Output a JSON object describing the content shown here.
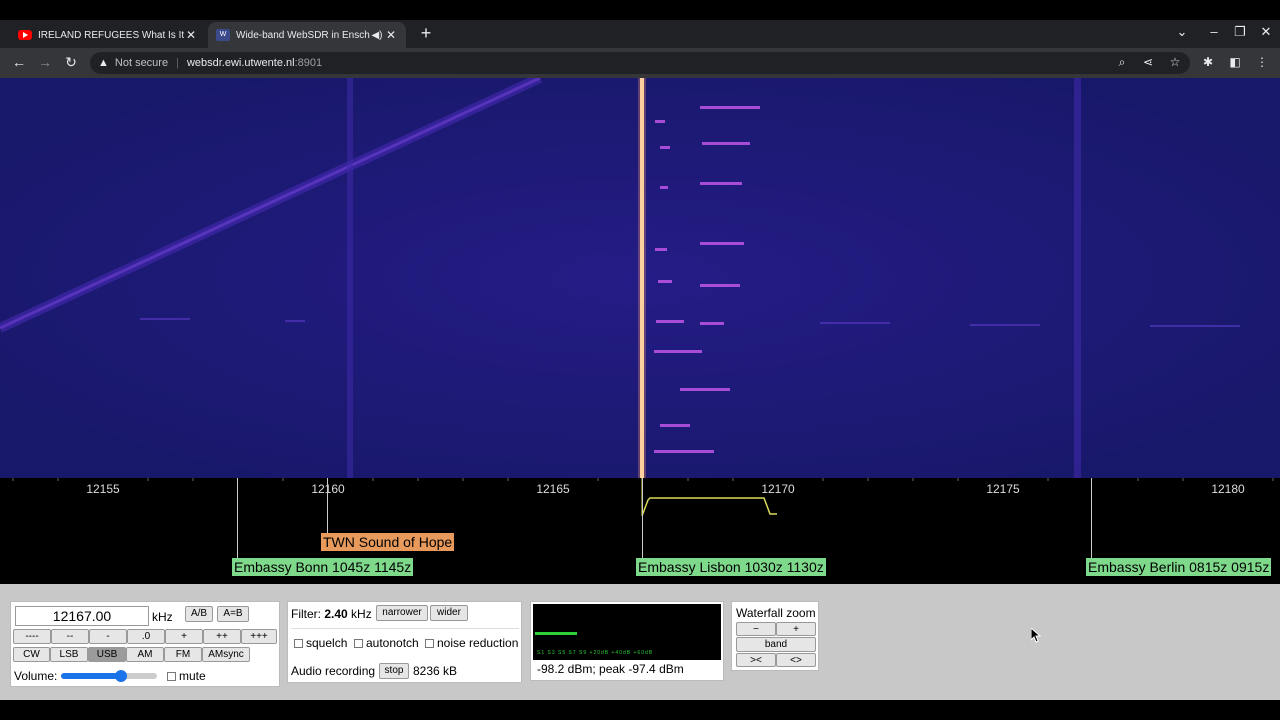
{
  "browser": {
    "tabs": [
      {
        "title": "IRELAND REFUGEES What Is It R",
        "favicon": "youtube-icon",
        "active": false
      },
      {
        "title": "Wide-band WebSDR in Ensch",
        "favicon": "websdr-icon",
        "active": true,
        "audio": true
      }
    ],
    "url_warning": "Not secure",
    "url_host": "websdr.ewi.utwente.nl",
    "url_port": ":8901"
  },
  "scale": {
    "ticks": [
      "12155",
      "12160",
      "12165",
      "12170",
      "12175",
      "12180"
    ]
  },
  "stations": [
    {
      "label": "TWN Sound of Hope",
      "color": "#e79a5b"
    },
    {
      "label": "Embassy Bonn 1045z 1145z",
      "color": "#7fd98b"
    },
    {
      "label": "Embassy Lisbon 1030z 1130z",
      "color": "#7fd98b"
    },
    {
      "label": "Embassy Berlin 0815z 0915z",
      "color": "#7fd98b"
    }
  ],
  "tuning": {
    "frequency": "12167.00",
    "unit": "kHz",
    "ab_label": "A/B",
    "aeqb_label": "A=B",
    "step_buttons": [
      "----",
      "--",
      "-",
      ".0",
      "+",
      "++",
      "+++"
    ],
    "modes": [
      "CW",
      "LSB",
      "USB",
      "AM",
      "FM",
      "AMsync"
    ],
    "selected_mode": "USB",
    "volume_label": "Volume:",
    "volume_level": 0.62,
    "mute_label": "mute"
  },
  "filter": {
    "label": "Filter:",
    "bandwidth": "2.40",
    "unit": "kHz",
    "narrower_label": "narrower",
    "wider_label": "wider",
    "squelch_label": "squelch",
    "autonotch_label": "autonotch",
    "noise_reduction_label": "noise reduction",
    "recording_label": "Audio recording",
    "stop_label": "stop",
    "recording_size": "8236 kB"
  },
  "smeter": {
    "marks": "S1  S3  S5  S7  S9  +20dB  +40dB  +60dB",
    "readout": "-98.2 dBm; peak  -97.4 dBm"
  },
  "zoom": {
    "title": "Waterfall zoom",
    "minus": "−",
    "plus": "+",
    "band": "band",
    "narrow": "><",
    "wide": "<>"
  }
}
